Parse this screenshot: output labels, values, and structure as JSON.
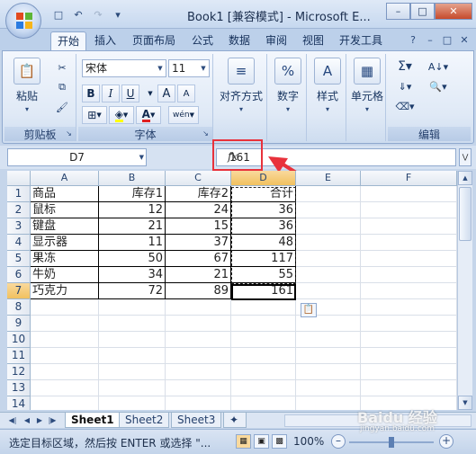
{
  "window": {
    "title": "Book1 [兼容模式] - Microsoft E...",
    "minimize_icon": "minimize-icon",
    "restore_icon": "restore-icon",
    "close_icon": "close-icon"
  },
  "quick_access": [
    "save-icon",
    "undo-icon",
    "redo-icon",
    "customize-icon"
  ],
  "tabs": [
    {
      "label": "开始",
      "active": true
    },
    {
      "label": "插入"
    },
    {
      "label": "页面布局"
    },
    {
      "label": "公式"
    },
    {
      "label": "数据"
    },
    {
      "label": "审阅"
    },
    {
      "label": "视图"
    },
    {
      "label": "开发工具"
    }
  ],
  "ribbon": {
    "clipboard": {
      "label": "剪贴板",
      "paste_label": "粘贴"
    },
    "font": {
      "label": "字体",
      "font_name": "宋体",
      "font_size": "11",
      "bold": "B",
      "italic": "I",
      "underline": "U",
      "grow": "A",
      "shrink": "A",
      "phonetic": "wén",
      "color_letter": "A",
      "font_color": "#e02020",
      "fill_color": "#ffff00"
    },
    "alignment": {
      "label": "对齐方式"
    },
    "number": {
      "label": "数字",
      "icon": "%"
    },
    "styles": {
      "label": "样式",
      "icon": "A"
    },
    "cells": {
      "label": "单元格"
    },
    "editing": {
      "label": "编辑"
    }
  },
  "formula_bar": {
    "name_box": "D7",
    "fx": "fx",
    "value": "161"
  },
  "sheet": {
    "columns": [
      "A",
      "B",
      "C",
      "D",
      "E",
      "F"
    ],
    "rows": [
      "1",
      "2",
      "3",
      "4",
      "5",
      "6",
      "7",
      "8",
      "9",
      "10",
      "11",
      "12",
      "13",
      "14"
    ],
    "data": [
      [
        "商品",
        "库存1",
        "库存2",
        "合计"
      ],
      [
        "鼠标",
        "12",
        "24",
        "36"
      ],
      [
        "键盘",
        "21",
        "15",
        "36"
      ],
      [
        "显示器",
        "11",
        "37",
        "48"
      ],
      [
        "果冻",
        "50",
        "67",
        "117"
      ],
      [
        "牛奶",
        "34",
        "21",
        "55"
      ],
      [
        "巧克力",
        "72",
        "89",
        "161"
      ]
    ],
    "selected_cell": "D7"
  },
  "sheet_tabs": [
    "Sheet1",
    "Sheet2",
    "Sheet3"
  ],
  "status": {
    "text": "选定目标区域，然后按 ENTER 或选择 \"...",
    "zoom": "100%"
  },
  "watermark": {
    "text": "Baidu 经验",
    "url": "jingyan.baidu.com"
  }
}
